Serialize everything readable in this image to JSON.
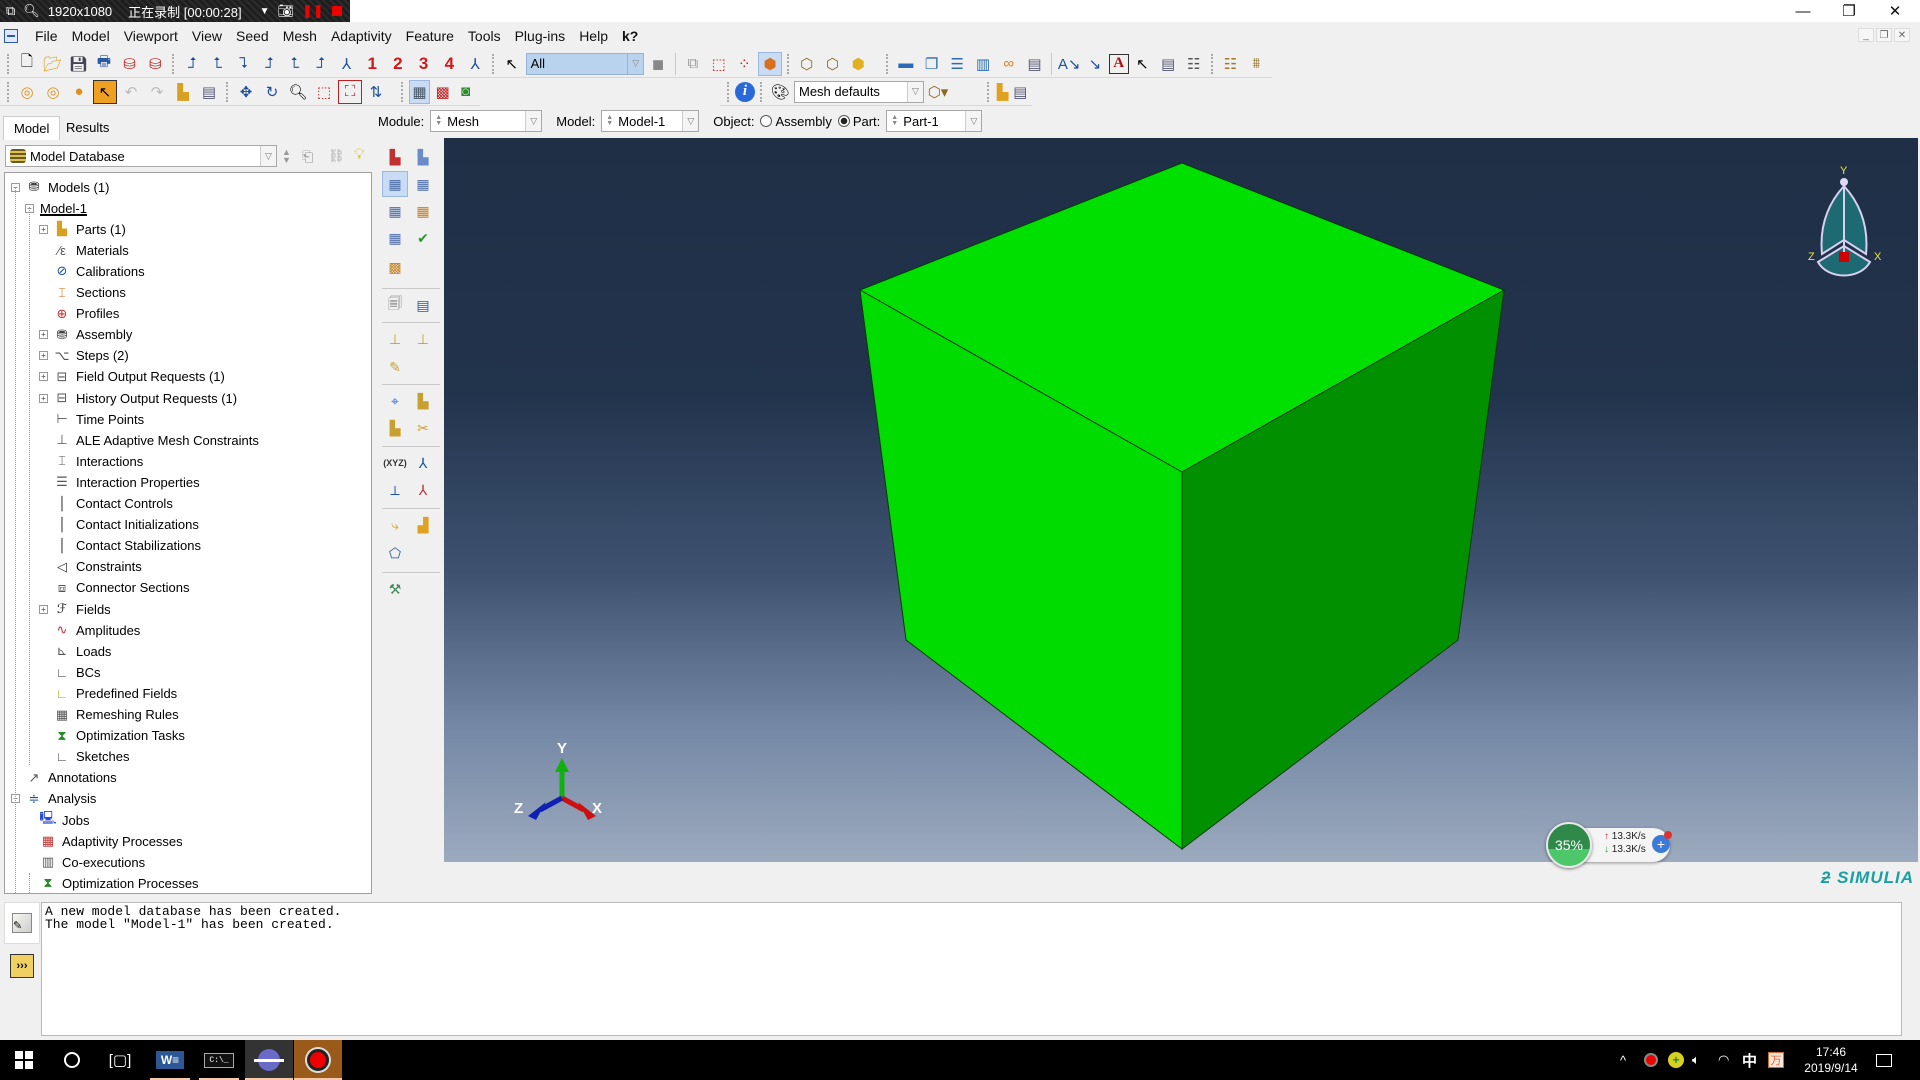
{
  "recorder": {
    "resolution": "1920x1080",
    "status": "正在录制 [00:00:28]"
  },
  "window_controls": {
    "minimize": "—",
    "restore": "❐",
    "close": "✕"
  },
  "menubar": {
    "items": [
      "File",
      "Model",
      "Viewport",
      "View",
      "Seed",
      "Mesh",
      "Adaptivity",
      "Feature",
      "Tools",
      "Plug-ins",
      "Help",
      "k?"
    ]
  },
  "toolbar": {
    "view_numbers": [
      "1",
      "2",
      "3",
      "4"
    ],
    "selection_filter": "All",
    "render_style": "Mesh defaults"
  },
  "context_bar": {
    "module_label": "Module:",
    "module_value": "Mesh",
    "model_label": "Model:",
    "model_value": "Model-1",
    "object_label": "Object:",
    "assembly_label": "Assembly",
    "part_label": "Part:",
    "part_value": "Part-1",
    "object_selected": "Part"
  },
  "left_panel": {
    "tabs": [
      "Model",
      "Results"
    ],
    "active_tab": "Model",
    "database": "Model Database",
    "tree": [
      {
        "label": "Models (1)",
        "level": 0,
        "expander": "minus",
        "icon": "models-icon"
      },
      {
        "label": "Model-1",
        "level": 1,
        "expander": "minus",
        "icon": "",
        "selected": true
      },
      {
        "label": "Parts (1)",
        "level": 2,
        "expander": "plus",
        "icon": "parts-icon"
      },
      {
        "label": "Materials",
        "level": 2,
        "expander": "",
        "icon": "materials-icon"
      },
      {
        "label": "Calibrations",
        "level": 2,
        "expander": "",
        "icon": "calibrations-icon"
      },
      {
        "label": "Sections",
        "level": 2,
        "expander": "",
        "icon": "sections-icon"
      },
      {
        "label": "Profiles",
        "level": 2,
        "expander": "",
        "icon": "profiles-icon"
      },
      {
        "label": "Assembly",
        "level": 2,
        "expander": "plus",
        "icon": "assembly-icon"
      },
      {
        "label": "Steps (2)",
        "level": 2,
        "expander": "plus",
        "icon": "steps-icon"
      },
      {
        "label": "Field Output Requests (1)",
        "level": 2,
        "expander": "plus",
        "icon": "field-output-icon"
      },
      {
        "label": "History Output Requests (1)",
        "level": 2,
        "expander": "plus",
        "icon": "history-output-icon"
      },
      {
        "label": "Time Points",
        "level": 2,
        "expander": "",
        "icon": "time-points-icon"
      },
      {
        "label": "ALE Adaptive Mesh Constraints",
        "level": 2,
        "expander": "",
        "icon": "ale-constraints-icon"
      },
      {
        "label": "Interactions",
        "level": 2,
        "expander": "",
        "icon": "interactions-icon"
      },
      {
        "label": "Interaction Properties",
        "level": 2,
        "expander": "",
        "icon": "interaction-properties-icon"
      },
      {
        "label": "Contact Controls",
        "level": 2,
        "expander": "",
        "icon": "contact-controls-icon"
      },
      {
        "label": "Contact Initializations",
        "level": 2,
        "expander": "",
        "icon": "contact-initializations-icon"
      },
      {
        "label": "Contact Stabilizations",
        "level": 2,
        "expander": "",
        "icon": "contact-stabilizations-icon"
      },
      {
        "label": "Constraints",
        "level": 2,
        "expander": "",
        "icon": "constraints-icon"
      },
      {
        "label": "Connector Sections",
        "level": 2,
        "expander": "",
        "icon": "connector-sections-icon"
      },
      {
        "label": "Fields",
        "level": 2,
        "expander": "plus",
        "icon": "fields-icon"
      },
      {
        "label": "Amplitudes",
        "level": 2,
        "expander": "",
        "icon": "amplitudes-icon"
      },
      {
        "label": "Loads",
        "level": 2,
        "expander": "",
        "icon": "loads-icon"
      },
      {
        "label": "BCs",
        "level": 2,
        "expander": "",
        "icon": "bcs-icon"
      },
      {
        "label": "Predefined Fields",
        "level": 2,
        "expander": "",
        "icon": "predefined-fields-icon"
      },
      {
        "label": "Remeshing Rules",
        "level": 2,
        "expander": "",
        "icon": "remeshing-rules-icon"
      },
      {
        "label": "Optimization Tasks",
        "level": 2,
        "expander": "",
        "icon": "optimization-tasks-icon"
      },
      {
        "label": "Sketches",
        "level": 2,
        "expander": "",
        "icon": "sketches-icon"
      },
      {
        "label": "Annotations",
        "level": 0,
        "expander": "",
        "icon": "annotations-icon"
      },
      {
        "label": "Analysis",
        "level": 0,
        "expander": "minus",
        "icon": "analysis-icon"
      },
      {
        "label": "Jobs",
        "level": 1,
        "expander": "",
        "icon": "jobs-icon"
      },
      {
        "label": "Adaptivity Processes",
        "level": 1,
        "expander": "",
        "icon": "adaptivity-processes-icon"
      },
      {
        "label": "Co-executions",
        "level": 1,
        "expander": "",
        "icon": "co-executions-icon"
      },
      {
        "label": "Optimization Processes",
        "level": 1,
        "expander": "",
        "icon": "optimization-processes-icon"
      }
    ]
  },
  "viewport": {
    "triad_labels": {
      "x": "X",
      "y": "Y",
      "z": "Z"
    },
    "viewcube_labels": {
      "x": "X",
      "y": "Y",
      "z": "Z"
    },
    "colors": {
      "cube_top": "#00e000",
      "cube_left": "#00dc00",
      "cube_right": "#009000",
      "edge": "#0a3a0a",
      "axis_x": "#cc1010",
      "axis_y": "#10b010",
      "axis_z": "#1020b0"
    },
    "brand": "SIMULIA"
  },
  "speed_widget": {
    "percent": "35%",
    "upload": "13.3K/s",
    "download": "13.3K/s"
  },
  "messages": [
    "A new model database has been created.",
    "The model \"Model-1\" has been created."
  ],
  "taskbar": {
    "apps": [
      "start",
      "search",
      "task-view",
      "word",
      "command-prompt",
      "abaqus",
      "screen-recorder"
    ],
    "ime": "中",
    "time": "17:46",
    "date": "2019/9/14"
  }
}
